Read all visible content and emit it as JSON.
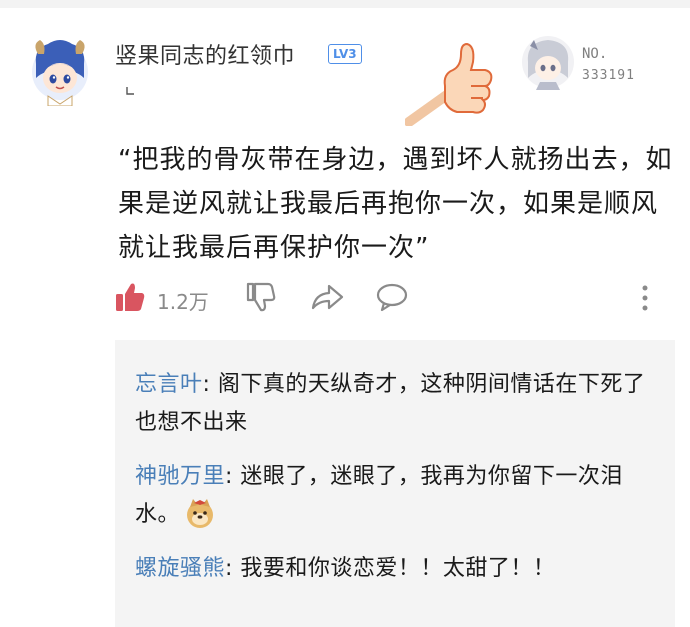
{
  "author": {
    "name": "竖果同志的红领巾",
    "level": "LV3"
  },
  "medal": {
    "label": "NO.",
    "number": "333191"
  },
  "comment": {
    "text": "“把我的骨灰带在身边，遇到坏人就扬出去，如果是逆风就让我最后再抱你一次，如果是顺风就让我最后再保护你一次”"
  },
  "actions": {
    "like_count": "1.2万"
  },
  "replies": [
    {
      "name": "忘言叶",
      "text": "阁下真的天纵奇才，这种阴间情话在下死了也想不出来"
    },
    {
      "name": "神驰万里",
      "text": "迷眼了，迷眼了，我再为你留下一次泪水。"
    },
    {
      "name": "螺旋骚熊",
      "text": "我要和你谈恋爱！！太甜了！！"
    }
  ],
  "colors": {
    "like_red": "#d95560",
    "reply_name_blue": "#4a7fb8",
    "level_blue": "#4f8fe8",
    "icon_gray": "#8a8a8a"
  },
  "icons": [
    "avatar",
    "level-badge",
    "thumb-up-art",
    "medal",
    "like-icon",
    "dislike-icon",
    "share-icon",
    "reply-icon",
    "more-icon",
    "doge-emoji-icon"
  ]
}
